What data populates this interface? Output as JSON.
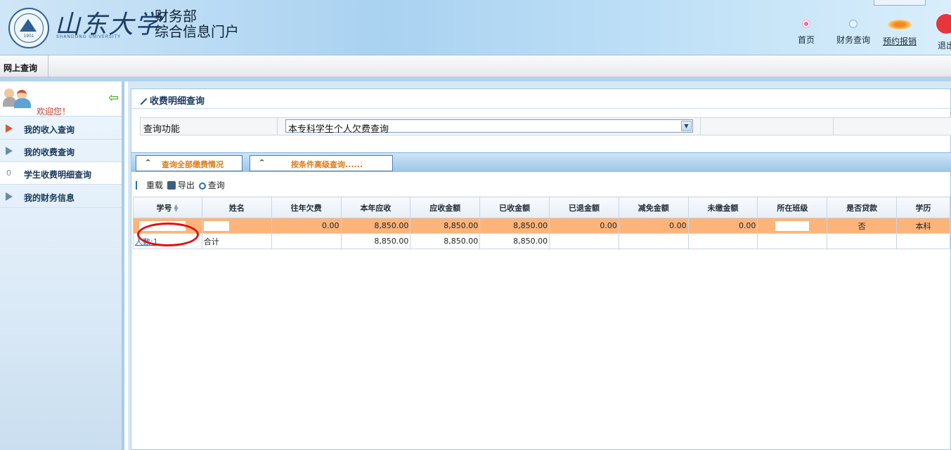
{
  "header": {
    "logo_calligraphy": "山东大学",
    "logo_english": "SHANDONG UNIVERSITY",
    "logo_year": "1901",
    "dept_line1": "财务部",
    "dept_line2": "综合信息门户",
    "nav": [
      {
        "label": "首页",
        "icon": "home-dot-icon"
      },
      {
        "label": "财务查询",
        "icon": "query-dot-icon"
      },
      {
        "label": "预约报销",
        "icon": "booking-icon"
      },
      {
        "label": "退出",
        "icon": "power-icon"
      }
    ]
  },
  "menubar": {
    "item": "网上查询"
  },
  "sidebar": {
    "welcome": "欢迎您！",
    "items": [
      {
        "label": "我的收入查询",
        "icon": "arrow-right-icon"
      },
      {
        "label": "我的收费查询",
        "icon": "arrow-right-icon"
      },
      {
        "label": "学生收费明细查询",
        "num": "0"
      },
      {
        "label": "我的财务信息",
        "icon": "arrow-right-icon"
      }
    ]
  },
  "panel": {
    "title": "收费明细查询",
    "query_label": "查询功能",
    "query_value": "本专科学生个人欠费查询",
    "tab1": "查询全部缴费情况",
    "tab2": "按条件高级查询......",
    "toolbar": {
      "reload": "重载",
      "export": "导出",
      "search": "查询"
    }
  },
  "table": {
    "columns": [
      "学号",
      "姓名",
      "往年欠费",
      "本年应收",
      "应收金额",
      "已收金额",
      "已退金额",
      "减免金额",
      "未缴金额",
      "所在班级",
      "是否贷款",
      "学历"
    ],
    "row": {
      "prior_arrears": "0.00",
      "current_receivable": "8,850.00",
      "receivable": "8,850.00",
      "received": "8,850.00",
      "refunded": "0.00",
      "waived": "0.00",
      "unpaid": "0.00",
      "loan": "否",
      "education": "本科"
    },
    "total": {
      "count_label": "人数:1",
      "label": "合计",
      "current_receivable": "8,850.00",
      "receivable": "8,850.00",
      "received": "8,850.00"
    }
  },
  "colors": {
    "selected_row": "#fcb47a",
    "annotation_circle": "#e01010",
    "tab_text": "#e07a12"
  }
}
